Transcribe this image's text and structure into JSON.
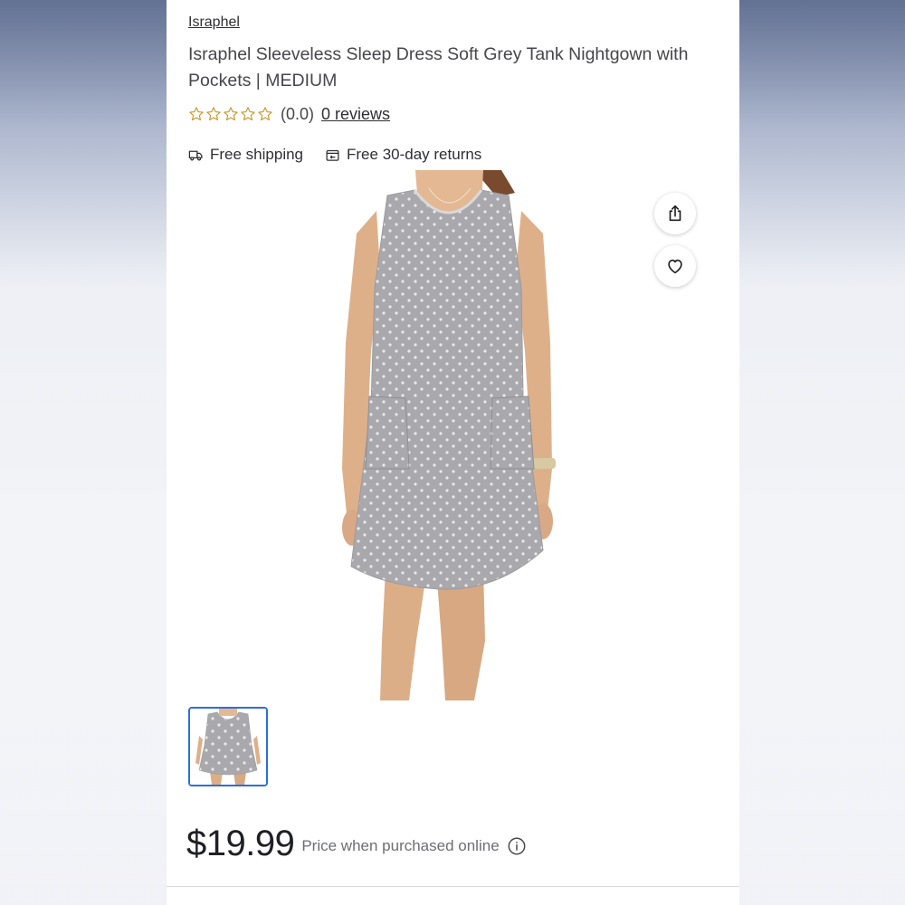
{
  "product": {
    "brand": "Israphel",
    "title": "Israphel Sleeveless Sleep Dress Soft Grey Tank Nightgown with Pockets | MEDIUM",
    "rating_value": "(0.0)",
    "stars_filled": 0,
    "stars_total": 5,
    "reviews_label": "0 reviews",
    "price": "$19.99",
    "price_note": "Price when purchased online"
  },
  "shipping": {
    "free_shipping": "Free shipping",
    "free_returns": "Free 30-day returns"
  },
  "icons": {
    "shipping": "truck-icon",
    "returns": "returns-icon",
    "share": "share-icon",
    "favorite": "heart-icon",
    "info": "info-icon",
    "star": "star-outline-icon"
  },
  "colors": {
    "star_outline": "#c9962a",
    "thumbnail_border": "#2a6fdb",
    "dress_grey": "#a9a9ad"
  }
}
